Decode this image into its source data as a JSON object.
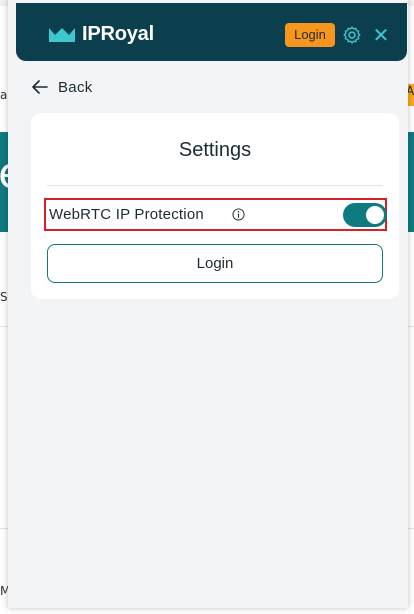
{
  "background": {
    "letter_big": "e",
    "letter_s1": "a",
    "letter_s2": "S",
    "letter_m": "M",
    "orange_text": "A"
  },
  "header": {
    "brand": "IPRoyal",
    "login_label": "Login",
    "close_glyph": "✕",
    "icons": {
      "logo": "crown-logo-icon",
      "settings": "gear-icon",
      "close": "close-icon"
    },
    "colors": {
      "header_bg": "#0b3f4d",
      "accent": "#3ec7cf",
      "login_bg": "#f7951d"
    }
  },
  "nav": {
    "back_label": "Back"
  },
  "settings": {
    "title": "Settings",
    "webrtc": {
      "label": "WebRTC IP Protection",
      "enabled": true
    },
    "login_button": "Login"
  }
}
